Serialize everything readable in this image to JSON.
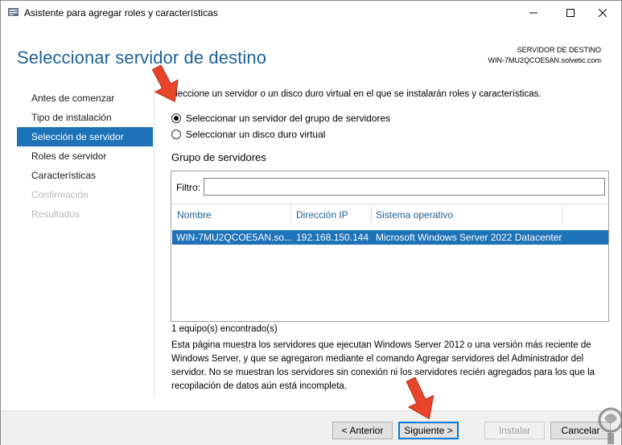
{
  "window": {
    "title": "Asistente para agregar roles y características"
  },
  "header": {
    "page_title": "Seleccionar servidor de destino",
    "dest_label": "SERVIDOR DE DESTINO",
    "dest_value": "WIN-7MU2QCOE5AN.solvetic.com"
  },
  "sidebar": {
    "items": [
      {
        "label": "Antes de comenzar",
        "state": "normal"
      },
      {
        "label": "Tipo de instalación",
        "state": "normal"
      },
      {
        "label": "Selección de servidor",
        "state": "active"
      },
      {
        "label": "Roles de servidor",
        "state": "normal"
      },
      {
        "label": "Características",
        "state": "normal"
      },
      {
        "label": "Confirmación",
        "state": "disabled"
      },
      {
        "label": "Resultados",
        "state": "disabled"
      }
    ]
  },
  "main": {
    "intro": "Seleccione un servidor o un disco duro virtual en el que se instalarán roles y características.",
    "option_pool": "Seleccionar un servidor del grupo de servidores",
    "option_vhd": "Seleccionar un disco duro virtual",
    "selected_option": "pool",
    "group_title": "Grupo de servidores",
    "filter_label": "Filtro:",
    "filter_value": "",
    "columns": [
      "Nombre",
      "Dirección IP",
      "Sistema operativo"
    ],
    "rows": [
      {
        "name": "WIN-7MU2QCOE5AN.so...",
        "ip": "192.168.150.144",
        "os": "Microsoft Windows Server 2022 Datacenter",
        "selected": true
      }
    ],
    "found_text": "1 equipo(s) encontrado(s)",
    "info_text": "Esta página muestra los servidores que ejecutan Windows Server 2012 o una versión más reciente de Windows Server, y que se agregaron mediante el comando Agregar servidores del Administrador del servidor. No se muestran los servidores sin conexión ni los servidores recién agregados para los que la recopilación de datos aún está incompleta."
  },
  "footer": {
    "back_label": "< Anterior",
    "next_label": "Siguiente >",
    "install_label": "Instalar",
    "cancel_label": "Cancelar"
  },
  "colors": {
    "accent": "#1e72b8",
    "title_blue": "#1e5f96",
    "arrow_red": "#e8442a"
  },
  "icons": {
    "app": "server-manager-icon",
    "minimize": "minimize-icon",
    "maximize": "maximize-icon",
    "close": "close-icon",
    "annotation": "red-arrow-icon",
    "watermark": "solvetic-logo-icon"
  }
}
